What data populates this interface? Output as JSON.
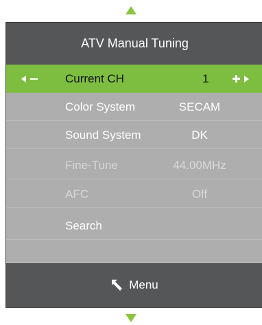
{
  "title": "ATV Manual Tuning",
  "current": {
    "label": "Current CH",
    "value": "1"
  },
  "rows": [
    {
      "label": "Color System",
      "value": "SECAM"
    },
    {
      "label": "Sound System",
      "value": "DK"
    },
    {
      "label": "Fine-Tune",
      "value": "44.00MHz"
    },
    {
      "label": "AFC",
      "value": "Off"
    },
    {
      "label": "Search",
      "value": ""
    }
  ],
  "footer": {
    "label": "Menu"
  },
  "colors": {
    "accent": "#7dbe41",
    "bar": "#545657",
    "panel": "#aeaeae"
  },
  "icons": [
    "scroll-up-icon",
    "left-arrow-icon",
    "minus-icon",
    "plus-icon",
    "right-arrow-icon",
    "back-icon",
    "scroll-down-icon"
  ]
}
